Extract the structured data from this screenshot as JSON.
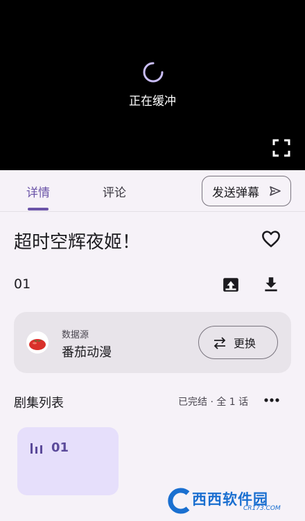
{
  "player": {
    "buffer_text": "正在缓冲"
  },
  "tabs": {
    "details": "详情",
    "comments": "评论",
    "danmaku": "发送弹幕"
  },
  "details": {
    "title": "超时空辉夜姬！",
    "episode": "01"
  },
  "source": {
    "caption": "数据源",
    "name": "番茄动漫",
    "switch_label": "更换"
  },
  "episodes": {
    "heading": "剧集列表",
    "status": "已完结 · 全 1 话",
    "items": [
      {
        "label": "01",
        "playing": true
      }
    ]
  },
  "watermark": {
    "text": "西西软件园",
    "sub": "CR173.COM"
  },
  "colors": {
    "accent": "#6b54a8",
    "episode_card": "#e6dffb",
    "source_card": "#e8e4ea",
    "player_bg": "#000000"
  }
}
